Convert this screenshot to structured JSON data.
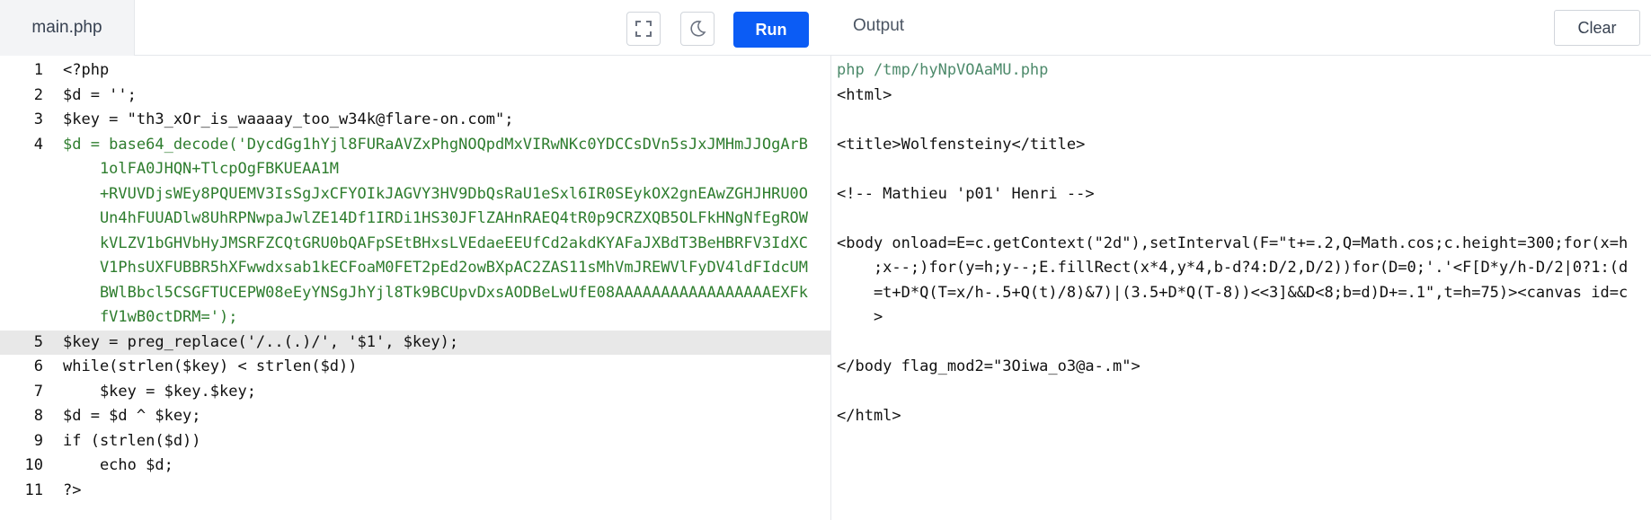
{
  "editor": {
    "tab_label": "main.php",
    "run_label": "Run",
    "lines": [
      {
        "num": "1",
        "text": "<?php"
      },
      {
        "num": "2",
        "text": "$d = '';"
      },
      {
        "num": "3",
        "text": "$key = \"th3_xOr_is_waaaay_too_w34k@flare-on.com\";"
      },
      {
        "num": "4",
        "text": "$d = base64_decode('DycdGg1hYjl8FURaAVZxPhgNOQpdMxVIRwNKc0YDCCsDVn5sJxJMHmJJOgArB"
      },
      {
        "num": "",
        "text": "    1olFA0JHQN+TlcpOgFBKUEAA1M"
      },
      {
        "num": "",
        "text": "    +RVUVDjsWEy8PQUEMV3IsSgJxCFYOIkJAGVY3HV9DbQsRaU1eSxl6IR0SEykOX2gnEAwZGHJHRU0O"
      },
      {
        "num": "",
        "text": "    Un4hFUUADlw8UhRPNwpaJwlZE14Df1IRDi1HS30JFlZAHnRAEQ4tR0p9CRZXQB5OLFkHNgNfEgROW"
      },
      {
        "num": "",
        "text": "    kVLZV1bGHVbHyJMSRFZCQtGRU0bQAFpSEtBHxsLVEdaeEEUfCd2akdKYAFaJXBdT3BeHBRFV3IdXC"
      },
      {
        "num": "",
        "text": "    V1PhsUXFUBBR5hXFwwdxsab1kECFoaM0FET2pEd2owBXpAC2ZAS11sMhVmJREWVlFyDV4ldFIdcUM"
      },
      {
        "num": "",
        "text": "    BWlBbcl5CSGFTUCEPW08eEyYNSgJhYjl8Tk9BCUpvDxsAODBeLwUfE08AAAAAAAAAAAAAAAAAEXFk"
      },
      {
        "num": "",
        "text": "    fV1wB0ctDRM=');"
      },
      {
        "num": "5",
        "text": "$key = preg_replace('/..(.)/', '$1', $key);"
      },
      {
        "num": "6",
        "text": "while(strlen($key) < strlen($d))"
      },
      {
        "num": "7",
        "text": "    $key = $key.$key;"
      },
      {
        "num": "8",
        "text": "$d = $d ^ $key;"
      },
      {
        "num": "9",
        "text": "if (strlen($d))"
      },
      {
        "num": "10",
        "text": "    echo $d;"
      },
      {
        "num": "11",
        "text": "?>"
      }
    ]
  },
  "output": {
    "title": "Output",
    "clear_label": "Clear",
    "lines": [
      "php /tmp/hyNpVOAaMU.php",
      "<html>",
      "",
      "<title>Wolfensteiny</title>",
      "",
      "<!-- Mathieu 'p01' Henri -->",
      "",
      "<body onload=E=c.getContext(\"2d\"),setInterval(F=\"t+=.2,Q=Math.cos;c.height=300;for(x=h",
      "    ;x--;)for(y=h;y--;E.fillRect(x*4,y*4,b-d?4:D/2,D/2))for(D=0;'.'<F[D*y/h-D/2|0?1:(d",
      "    =t+D*Q(T=x/h-.5+Q(t)/8)&7)|(3.5+D*Q(T-8))<<3]&&D<8;b=d)D+=.1\",t=h=75)><canvas id=c",
      "    >",
      "",
      "</body flag_mod2=\"3Oiwa_o3@a-.m\">",
      "",
      "</html>"
    ]
  },
  "icons": [
    "fullscreen-icon",
    "moon-icon"
  ],
  "colors": {
    "run_button": "#0b5cf5",
    "variable": "#3a7b9c",
    "string": "#2e7d2e",
    "keyword": "#1f3fbf",
    "highlight_line": "#e8e8e8"
  }
}
